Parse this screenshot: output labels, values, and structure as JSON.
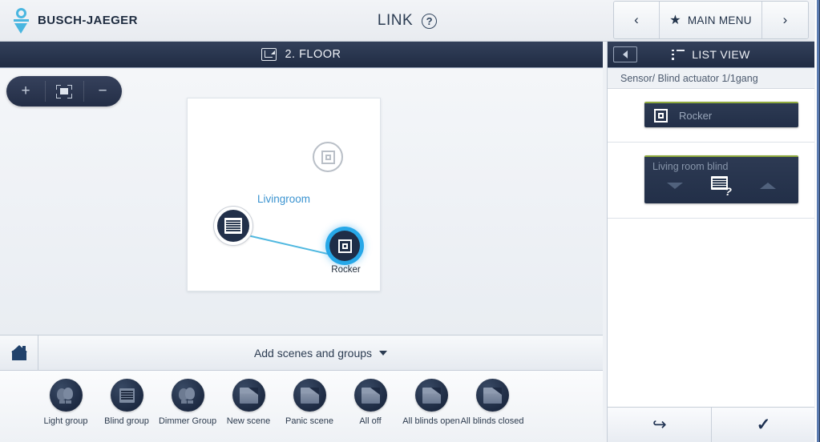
{
  "header": {
    "brand_name": "BUSCH-JAEGER",
    "brand_logo_icon": "busch-jaeger-logo",
    "app_title": "LINK",
    "help_icon": "question-mark-circle-icon",
    "nav": {
      "prev_icon": "chevron-left-icon",
      "prev_label": "‹",
      "next_icon": "chevron-right-icon",
      "next_label": "›",
      "main_menu_label": "MAIN MENU",
      "main_menu_icon": "star-icon",
      "star_glyph": "★"
    }
  },
  "floor_bar": {
    "icon": "floorplan-icon",
    "title": "2. FLOOR"
  },
  "canvas": {
    "zoom_controls": {
      "zoom_in_label": "+",
      "zoom_in_icon": "plus-icon",
      "fit_icon": "fit-to-screen-icon",
      "zoom_out_label": "−",
      "zoom_out_icon": "minus-icon"
    },
    "room": {
      "label": "Livingroom",
      "ghost_node_icon": "rocker-outline-icon",
      "nodes": [
        {
          "name": "blind-actuator",
          "icon": "blind-icon",
          "caption": ""
        },
        {
          "name": "rocker",
          "icon": "rocker-icon",
          "caption": "Rocker"
        }
      ]
    }
  },
  "add_bar": {
    "home_icon": "home-icon",
    "label": "Add scenes and groups",
    "chevron_icon": "chevron-down-icon"
  },
  "scene_strip": {
    "items": [
      {
        "label": "Light group",
        "icon": "light-bulbs-icon",
        "type": "bulbs"
      },
      {
        "label": "Blind group",
        "icon": "blind-icon",
        "type": "blind"
      },
      {
        "label": "Dimmer Group",
        "icon": "light-bulbs-icon",
        "type": "bulbs"
      },
      {
        "label": "New scene",
        "icon": "clapperboard-icon",
        "type": "clapper"
      },
      {
        "label": "Panic scene",
        "icon": "clapperboard-icon",
        "type": "clapper"
      },
      {
        "label": "All off",
        "icon": "clapperboard-icon",
        "type": "clapper"
      },
      {
        "label": "All blinds open",
        "icon": "clapperboard-icon",
        "type": "clapper"
      },
      {
        "label": "All blinds closed",
        "icon": "clapperboard-icon",
        "type": "clapper"
      }
    ]
  },
  "right_panel": {
    "collapse_icon": "collapse-panel-icon",
    "list_icon": "list-view-icon",
    "title": "LIST VIEW",
    "subtitle": "Sensor/ Blind actuator 1/1gang",
    "cards": [
      {
        "name": "rocker-card",
        "label": "Rocker",
        "icon": "rocker-icon"
      },
      {
        "name": "living-room-blind-card",
        "label": "Living room blind",
        "down_icon": "chevron-down-icon",
        "blind_icon": "blind-unknown-icon",
        "question_glyph": "?",
        "up_icon": "chevron-up-icon"
      }
    ],
    "footer": {
      "back_label": "↩",
      "back_icon": "undo-arrow-icon",
      "confirm_label": "✓",
      "confirm_icon": "checkmark-icon"
    }
  },
  "colors": {
    "brand_accent": "#49b6e0",
    "dark_bar": "#26324b",
    "link_line": "#4fb8e0",
    "selection_glow": "#27a8e8",
    "card_top_border": "#8faa3e",
    "room_label": "#3a93d0"
  }
}
